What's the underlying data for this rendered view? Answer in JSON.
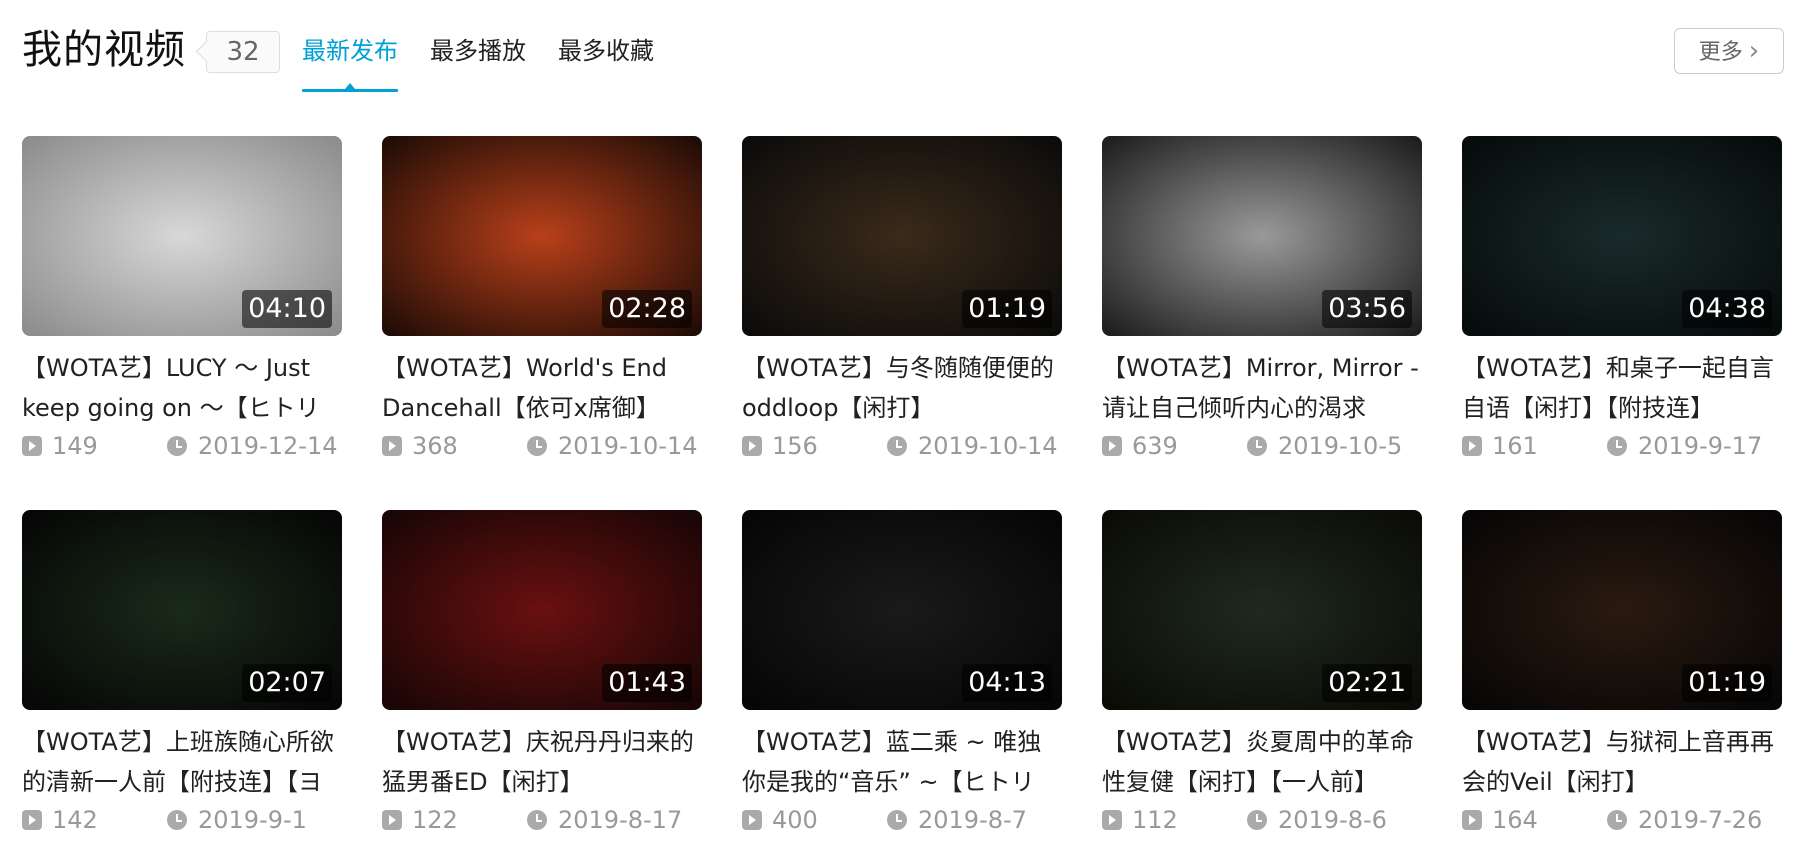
{
  "header": {
    "title": "我的视频",
    "count": "32",
    "tabs": [
      {
        "label": "最新发布",
        "active": true
      },
      {
        "label": "最多播放",
        "active": false
      },
      {
        "label": "最多收藏",
        "active": false
      }
    ],
    "more_label": "更多"
  },
  "videos": [
    {
      "duration": "04:10",
      "title": "【WOTA艺】LUCY ～ Just keep going on ～【ヒトリ",
      "views": "149",
      "date": "2019-12-14",
      "thumb_colors": [
        "#d8d8d8",
        "#8a8a8a"
      ]
    },
    {
      "duration": "02:28",
      "title": "【WOTA艺】World's End Dancehall【依可x席御】",
      "views": "368",
      "date": "2019-10-14",
      "thumb_colors": [
        "#b8401a",
        "#1a0a05"
      ]
    },
    {
      "duration": "01:19",
      "title": "【WOTA艺】与冬随随便便的oddloop【闲打】",
      "views": "156",
      "date": "2019-10-14",
      "thumb_colors": [
        "#3a2a1a",
        "#0a0a0a"
      ]
    },
    {
      "duration": "03:56",
      "title": "【WOTA艺】Mirror, Mirror -请让自己倾听内心的渴求",
      "views": "639",
      "date": "2019-10-5",
      "thumb_colors": [
        "#9a9a9a",
        "#1a1a1a"
      ]
    },
    {
      "duration": "04:38",
      "title": "【WOTA艺】和桌子一起自言自语【闲打】【附技连】",
      "views": "161",
      "date": "2019-9-17",
      "thumb_colors": [
        "#1a2a2a",
        "#050a0a"
      ]
    },
    {
      "duration": "02:07",
      "title": "【WOTA艺】上班族随心所欲的清新一人前【附技连】【ヨ",
      "views": "142",
      "date": "2019-9-1",
      "thumb_colors": [
        "#1a2a1a",
        "#050505"
      ]
    },
    {
      "duration": "01:43",
      "title": "【WOTA艺】庆祝丹丹归来的猛男番ED【闲打】",
      "views": "122",
      "date": "2019-8-17",
      "thumb_colors": [
        "#6a1010",
        "#150505"
      ]
    },
    {
      "duration": "04:13",
      "title": "【WOTA艺】蓝二乘 ~ 唯独你是我的“音乐” ~【ヒトリ",
      "views": "400",
      "date": "2019-8-7",
      "thumb_colors": [
        "#1a1a1a",
        "#050505"
      ]
    },
    {
      "duration": "02:21",
      "title": "【WOTA艺】炎夏周中的革命性复健【闲打】【一人前】",
      "views": "112",
      "date": "2019-8-6",
      "thumb_colors": [
        "#1f2a1f",
        "#0a0a05"
      ]
    },
    {
      "duration": "01:19",
      "title": "【WOTA艺】与狱祠上音再再会的Veil【闲打】",
      "views": "164",
      "date": "2019-7-26",
      "thumb_colors": [
        "#2a1a10",
        "#050505"
      ]
    }
  ]
}
